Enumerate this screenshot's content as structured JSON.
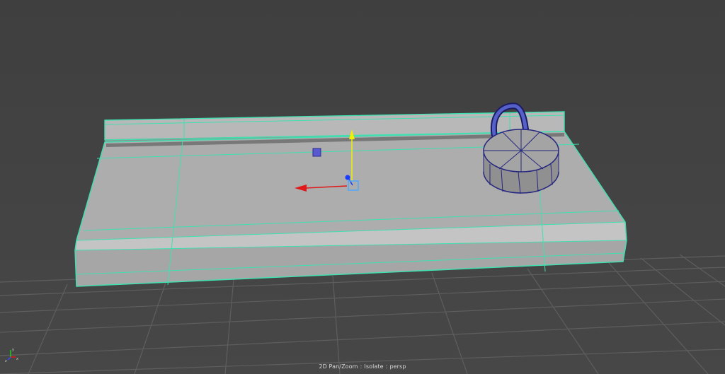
{
  "viewport": {
    "camera": "persp",
    "mode": "2D Pan/Zoom",
    "isolate": "Isolate",
    "separator": ":",
    "background": "#444444",
    "selection_wire_color": "#40e0b0",
    "grid_color": "#5e5e5e",
    "axis_x_color": "#ff2020",
    "axis_y_color": "#ffff00",
    "axis_z_color": "#1a3cff"
  },
  "objects": [
    {
      "name": "countertop",
      "selected": true,
      "icon": "selected-wireframe"
    },
    {
      "name": "backsplash",
      "selected": true,
      "icon": "selected-wireframe"
    },
    {
      "name": "faucet",
      "selected": false,
      "icon": "blue-wireframe"
    }
  ],
  "manipulator": {
    "type": "move-tool",
    "icon": "move-manipulator-icon"
  },
  "view_axis": {
    "icon": "xyz-axis-indicator-icon"
  }
}
